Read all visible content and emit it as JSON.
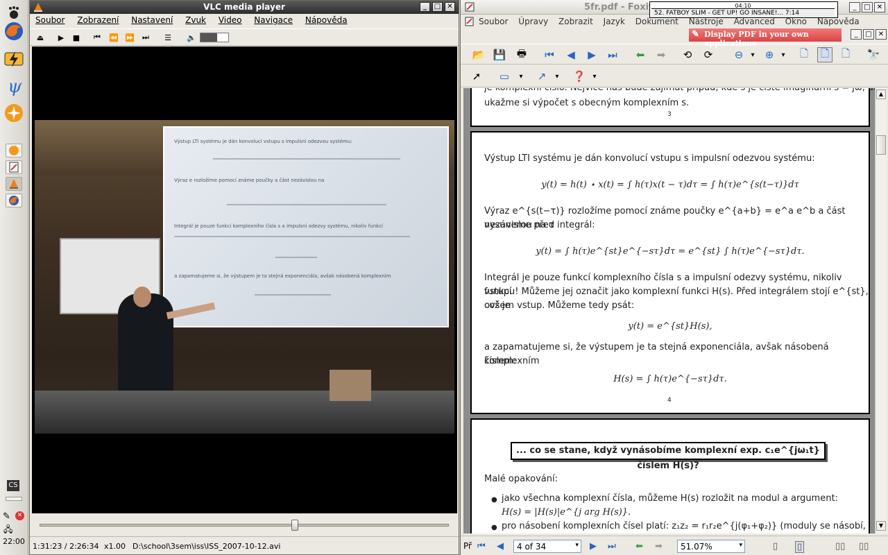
{
  "taskbar": {
    "clock": "22:00",
    "tray_label": "CS"
  },
  "vlc": {
    "title": "VLC media player",
    "menu": [
      "Soubor",
      "Zobrazení",
      "Nastavení",
      "Zvuk",
      "Video",
      "Navigace",
      "Nápověda"
    ],
    "status": {
      "time": "1:31:23 / 2:26:34",
      "speed": "x1.00",
      "file": "D:\\school\\3sem\\iss\\ISS_2007-10-12.avi"
    },
    "seek_position": 0.624
  },
  "foxit": {
    "title": "5fr.pdf - Foxit I",
    "media_strip": {
      "top": "04:10",
      "track": "52. FATBOY SLIM - GET UP! GO INSANE!... 7:14"
    },
    "menu": [
      "Soubor",
      "Úpravy",
      "Zobrazit",
      "Jazyk",
      "Dokument",
      "Nástroje",
      "Advanced",
      "Okno",
      "Nápověda"
    ],
    "banner": "Display PDF in your own applications",
    "status": {
      "prefix": "Př",
      "page": "4 of 34",
      "zoom": "51.07%"
    },
    "pages": {
      "top_fragment_line1": "je komplexní číslo. Nejvíce nás bude zajímat případ, kde s je čistě imaginární s = jω, ale",
      "top_fragment_line2": "ukažme si výpočet s obecným komplexním s.",
      "top_fragment_pagenum": "3",
      "p4": {
        "l1": "Výstup LTI systému je dán konvolucí vstupu s impulsní odezvou systému:",
        "eq1": "y(t) = h(t) ⋆ x(t) = ∫ h(τ)x(t − τ)dτ = ∫ h(τ)e^{s(t−τ)}dτ",
        "l2": "Výraz e^{s(t−τ)} rozložíme pomocí známe poučky e^{a+b} = e^a e^b a část nezávislou na τ",
        "l3": "vysuneme před integrál:",
        "eq2": "y(t) = ∫ h(τ)e^{st}e^{−sτ}dτ = e^{st} ∫ h(τ)e^{−sτ}dτ.",
        "l4": "Integrál je pouze funkcí komplexního čísla s a impulsní odezvy systému, nikoliv funkcí",
        "l5": "vstupu! Můžeme jej označit jako komplexní funkci H(s). Před integrálem stojí e^{st}, což je",
        "l6": "ovšem vstup. Můžeme tedy psát:",
        "eq3": "y(t) = e^{st}H(s),",
        "l7": "a zapamatujeme si, že výstupem je ta stejná exponenciála, avšak násobená komplexním",
        "l8": "číslem:",
        "eq4": "H(s) = ∫ h(τ)e^{−sτ}dτ.",
        "pagenum": "4"
      },
      "p5": {
        "heading": "... co se stane, když vynásobíme komplexní exp. c₁e^{jω₁t} číslem H(s)?",
        "l1": "Malé opakování:",
        "b1": "jako všechna komplexní čísla, můžeme H(s) rozložit na modul a argument:",
        "b1eq": "H(s) = |H(s)|e^{j arg H(s)}.",
        "b2": "pro násobení komplexních čísel platí: z₁z₂ = r₁r₂e^{j(φ₁+φ₂)} (moduly se násobí,"
      }
    }
  },
  "lecture_slide": {
    "line1": "Výstup LTI systému je dán konvolucí vstupu s impulsní odezvou systému:",
    "line2": "Výraz e rozložíme pomocí známe poučky a část nezávislou na",
    "line3": "Integrál je pouze funkcí komplexního čísla s a impulsní odezvy systému, nikoliv funkcí",
    "line4": "a zapamatujeme si, že výstupem je ta stejná exponenciála, avšak násobená komplexním"
  }
}
